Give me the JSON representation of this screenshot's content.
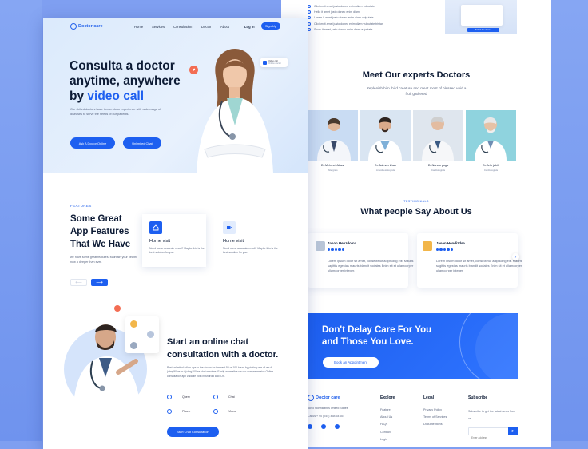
{
  "colors": {
    "brand": "#1d5ff0",
    "dark": "#0d1b35",
    "muted": "#5a6680",
    "backdrop": "#7f9ff1",
    "accent": "#f36d53"
  },
  "left": {
    "logo": "Doctor care",
    "nav": [
      "Home",
      "Services",
      "Consultation",
      "Doctor",
      "About",
      "Log In"
    ],
    "signup": "Sign Up",
    "hero": {
      "title_line1": "Consulta a doctor",
      "title_line2": "anytime, anywhere",
      "title_prefix": "by ",
      "title_accent": "video call",
      "desc": "Our skilled doctors have tremendous experience with wide range of diseases to serve the needs of our patients.",
      "btn_primary": "Ask A Doctor Online",
      "btn_secondary": "Unlimited Chat"
    },
    "video_chip": {
      "line1": "Video call",
      "line2": "Online doctor"
    },
    "features": {
      "tag": "FEATURES",
      "title": "Some Great App Features That We Have",
      "desc": "we have some great features. Maintain your health now a deeper than ever.",
      "prev_icon": "arrow-left-icon",
      "next_icon": "arrow-right-icon",
      "cards": [
        {
          "title": "Home visit",
          "desc": "Need some accurate result? Maybe this is the best solution for you",
          "icon": "home-icon"
        },
        {
          "title": "Home visit",
          "desc": "Need some accurate result? Maybe this is the best solution for you",
          "icon": "video-icon"
        }
      ]
    },
    "consult": {
      "title": "Start an online chat consultation with a doctor.",
      "desc": "Post unlimited follow-ups to the doctor for the next 50 or 100 hours by picking one of our # (chng90hrs or #(chng100hrs chat services. Easily accessible via our comprehensive Online consultation app vailable both in Android and iOS.",
      "options": [
        "Query",
        "Chat",
        "Phone",
        "Video"
      ],
      "button": "Start Chat Consultation"
    }
  },
  "right": {
    "checks": [
      "Clicium it amet justo donec enim diam vulputate",
      "Hello it amet justo donec enim diam",
      "Lorem it amet justo donec enim diam vulputate",
      "Clicium it amet justo donec enim diam vulputate tristan",
      "Show it amet justo donec enim diam vulputate"
    ],
    "mini_card_btn": "Submit for a Bonus",
    "experts": {
      "title": "Meet Our experts Doctors",
      "subtitle": "Replenish him third creature and meat most of blessed void a fruit gathered",
      "doctors": [
        {
          "name": "Dr.Mehmet Abasi",
          "role": "Allergists"
        },
        {
          "name": "Dr.Salman khan",
          "role": "Anesthesiologists"
        },
        {
          "name": "Dr.Nundo yoga",
          "role": "Cardiologists"
        },
        {
          "name": "Dr.Jelo jakih",
          "role": "Cardiologists"
        }
      ]
    },
    "testimonials": {
      "tag": "TESTIMONIALS",
      "title": "What people Say About Us",
      "items": [
        {
          "name": "Jason Henzdoina",
          "text": "Lorem ipsum dolor sit amet, consectetur adipiscing elit. Mauris sagittis egestas mauris blandit sodales Enim sit et ullamcorper ullamcorper integer."
        },
        {
          "name": "Jason Hendizdsa",
          "text": "Lorem ipsum dolor sit amet, consectetur adipiscing elit. Mauris sagittis egestas mauris blandit sodales Enim sit et ullamcorper ullamcorper integer."
        }
      ]
    },
    "cta": {
      "title": "Don't Delay Care For You and Those You Love.",
      "button": "Book an Appointment"
    },
    "footer": {
      "logo": "Doctor care",
      "address": "3895 NorthBanes United States",
      "phone": "Callus + 90 (254) 458 54 55",
      "social": [
        "facebook-icon",
        "twitter-icon",
        "instagram-icon"
      ],
      "explore_title": "Explore",
      "explore": [
        "Feature",
        "About Us",
        "FAQs",
        "Contact",
        "Login"
      ],
      "legal_title": "Legal",
      "legal": [
        "Privacy Policy",
        "Terms of Services",
        "Documentions"
      ],
      "subscribe_title": "Subscribe",
      "subscribe_text": "Subscribe to get the latest news from us",
      "email_placeholder": "Enter address"
    }
  }
}
